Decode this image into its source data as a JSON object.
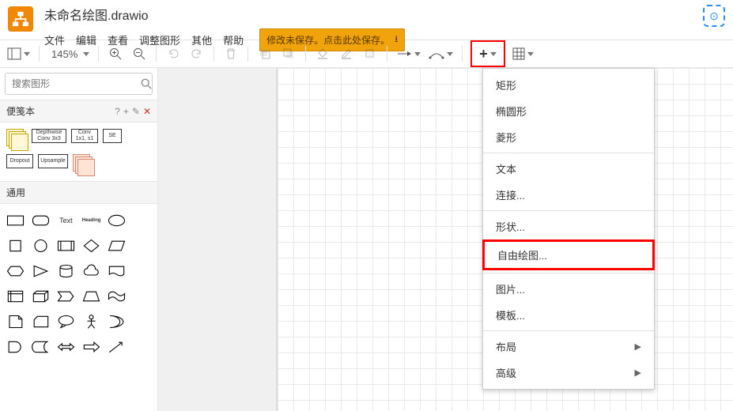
{
  "header": {
    "title": "未命名绘图.drawio",
    "menus": [
      "文件",
      "编辑",
      "查看",
      "调整图形",
      "其他",
      "帮助"
    ],
    "save_warning": "修改未保存。点击此处保存。"
  },
  "toolbar": {
    "zoom": "145%"
  },
  "search": {
    "placeholder": "搜索图形"
  },
  "panels": {
    "scratchpad": "便笺本",
    "scratch_items": [
      "Depthwise Conv 3x3",
      "Conv 1x1, s1",
      "SE",
      "Dropout",
      "Upsample"
    ],
    "general": "通用",
    "general_labels": {
      "text": "Text",
      "heading": "Heading"
    }
  },
  "menu": {
    "rectangle": "矩形",
    "ellipse": "椭圆形",
    "rhombus": "菱形",
    "text": "文本",
    "link": "连接...",
    "shapes": "形状...",
    "freehand": "自由绘图...",
    "image": "图片...",
    "template": "模板...",
    "layout": "布局",
    "advanced": "高级"
  }
}
